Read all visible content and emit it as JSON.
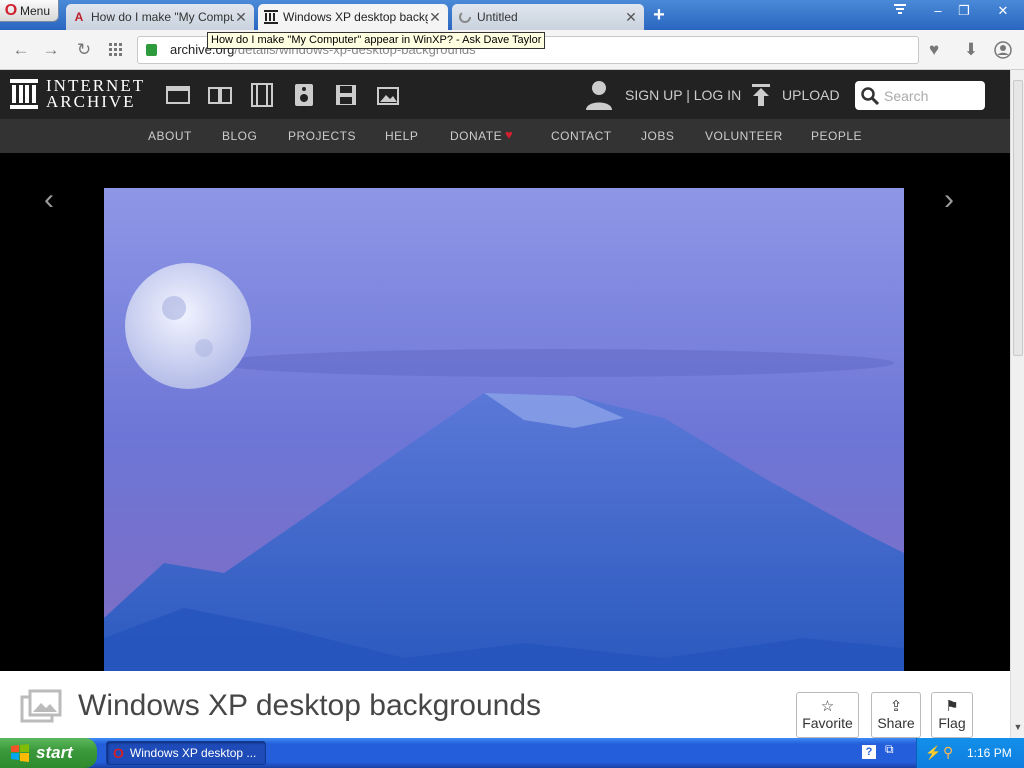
{
  "browser": {
    "menu_label": "Menu",
    "tabs": [
      {
        "title": "How do I make \"My Computer\" appear in WinXP? - Ask Dave Taylor",
        "short": "How do I make \"My Computer",
        "icon": "ask-dave-icon"
      },
      {
        "title": "Windows XP desktop backgrounds",
        "short": "Windows XP desktop backgro",
        "icon": "archive-icon"
      },
      {
        "title": "Untitled",
        "short": "Untitled",
        "icon": "loading-icon"
      }
    ],
    "tooltip": "How do I make \"My Computer\" appear in WinXP? - Ask Dave Taylor",
    "url_host": "archive.org",
    "url_path": "/details/windows-xp-desktop-backgrounds"
  },
  "archive": {
    "logo_line1": "INTERNET",
    "logo_line2": "ARCHIVE",
    "signup": "SIGN UP | LOG IN",
    "upload": "UPLOAD",
    "search_placeholder": "Search",
    "nav": [
      "ABOUT",
      "BLOG",
      "PROJECTS",
      "HELP",
      "DONATE",
      "CONTACT",
      "JOBS",
      "VOLUNTEER",
      "PEOPLE"
    ]
  },
  "item": {
    "title": "Windows XP desktop backgrounds",
    "favorite": "Favorite",
    "share": "Share",
    "flag": "Flag"
  },
  "taskbar": {
    "start": "start",
    "task": "Windows XP desktop ...",
    "clock": "1:16 PM"
  },
  "colors": {
    "donate_heart": "#d1202e",
    "opera_red": "#d1202e",
    "xp_blue": "#245edb"
  }
}
